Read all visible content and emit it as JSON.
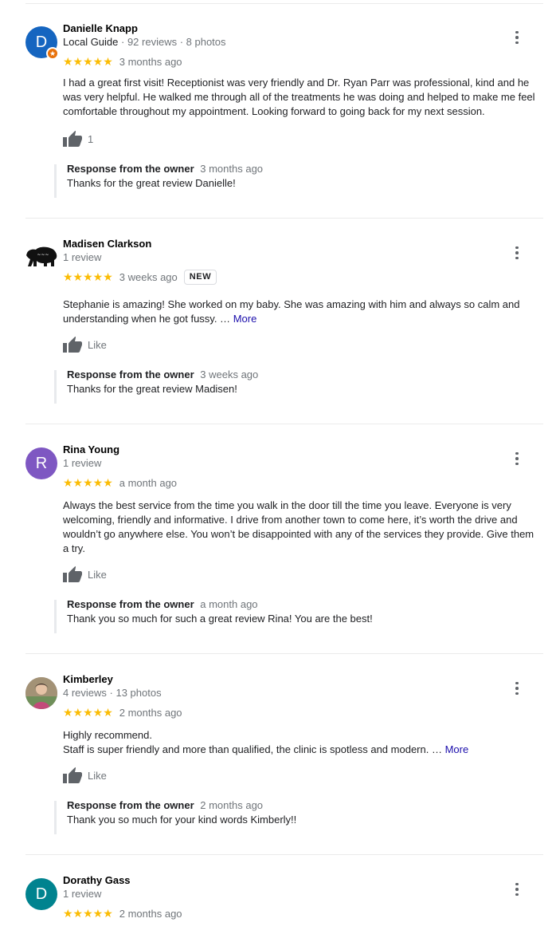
{
  "reviews": [
    {
      "name": "Danielle Knapp",
      "avatar_letter": "D",
      "avatar_color": "#1565c0",
      "local_guide": true,
      "guide_label": "Local Guide",
      "meta": "92 reviews · 8 photos",
      "stars": "★★★★★",
      "rating": 5,
      "date": "3 months ago",
      "badge": "",
      "text": "I had a great first visit! Receptionist was very friendly and Dr. Ryan Parr was professional, kind and he was very helpful. He walked me through all of the treatments he was doing and helped to make me feel comfortable throughout my appointment. Looking forward to going back for my next session.",
      "more_label": "",
      "like_label": "1",
      "response": {
        "owner_label": "Response from the owner",
        "date": "3 months ago",
        "text": "Thanks for the great review Danielle!"
      }
    },
    {
      "name": "Madisen Clarkson",
      "avatar_letter": "",
      "avatar_color": "#ffffff",
      "avatar_icon": "bear-logo-icon",
      "local_guide": false,
      "meta": "1 review",
      "stars": "★★★★★",
      "rating": 5,
      "date": "3 weeks ago",
      "badge": "NEW",
      "text": "Stephanie is amazing! She worked on my baby. She was amazing with him and always so calm and understanding when he got fussy. …",
      "more_label": "More",
      "like_label": "Like",
      "response": {
        "owner_label": "Response from the owner",
        "date": "3 weeks ago",
        "text": "Thanks for the great review Madisen!"
      }
    },
    {
      "name": "Rina Young",
      "avatar_letter": "R",
      "avatar_color": "#7e57c2",
      "local_guide": false,
      "meta": "1 review",
      "stars": "★★★★★",
      "rating": 5,
      "date": "a month ago",
      "badge": "",
      "text": "Always the best service from the time you walk in the door till the time you leave. Everyone is very welcoming, friendly and informative. I drive from another town to come here, it’s worth the drive and wouldn’t go anywhere else. You won’t be disappointed with any of the services they provide. Give them a try.",
      "more_label": "",
      "like_label": "Like",
      "response": {
        "owner_label": "Response from the owner",
        "date": "a month ago",
        "text": "Thank you so much for such a great review Rina! You are the best!"
      }
    },
    {
      "name": "Kimberley",
      "avatar_letter": "",
      "avatar_color": "#8d7b6a",
      "avatar_icon": "profile-photo-icon",
      "local_guide": false,
      "meta": "4 reviews · 13 photos",
      "stars": "★★★★★",
      "rating": 5,
      "date": "2 months ago",
      "badge": "",
      "text_line1": "Highly recommend.",
      "text": "Staff is super friendly and more than qualified, the clinic is spotless and modern. …",
      "more_label": "More",
      "like_label": "Like",
      "response": {
        "owner_label": "Response from the owner",
        "date": "2 months ago",
        "text": "Thank you so much for your kind words Kimberly!!"
      }
    },
    {
      "name": "Dorathy Gass",
      "avatar_letter": "D",
      "avatar_color": "#00838f",
      "local_guide": false,
      "meta": "1 review",
      "stars": "★★★★★",
      "rating": 5,
      "date": "2 months ago",
      "badge": ""
    }
  ]
}
